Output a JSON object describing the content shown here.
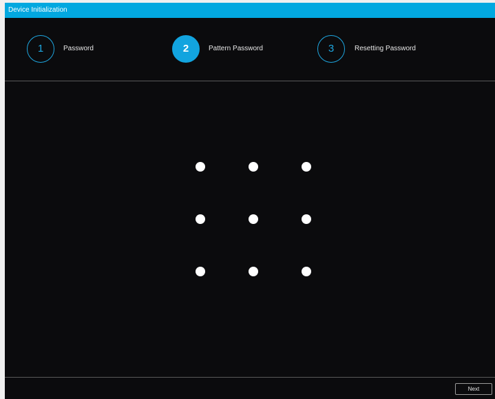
{
  "window": {
    "title": "Device Initialization"
  },
  "steps": [
    {
      "number": "1",
      "label": "Password",
      "state": "inactive"
    },
    {
      "number": "2",
      "label": "Pattern Password",
      "state": "active"
    },
    {
      "number": "3",
      "label": "Resetting Password",
      "state": "inactive"
    }
  ],
  "pattern": {
    "rows": 3,
    "cols": 3
  },
  "footer": {
    "next_label": "Next"
  },
  "colors": {
    "accent": "#02a8e0",
    "background": "#0b0b0d",
    "dot": "#ffffff",
    "divider": "#5a5a5a"
  }
}
